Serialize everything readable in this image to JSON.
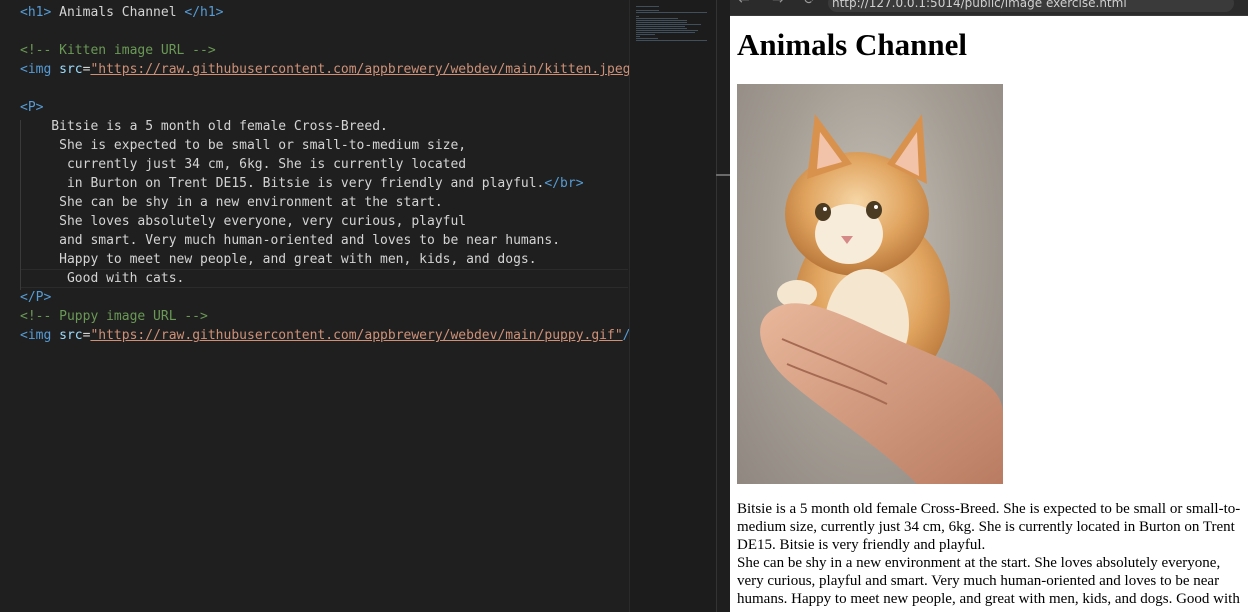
{
  "editor": {
    "lines": [
      [
        {
          "t": "tag",
          "v": "<h1>"
        },
        {
          "t": "txt",
          "v": " Animals Channel "
        },
        {
          "t": "tag",
          "v": "</h1>"
        }
      ],
      [],
      [
        {
          "t": "cmt",
          "v": "<!-- Kitten image URL -->"
        }
      ],
      [
        {
          "t": "tag",
          "v": "<img "
        },
        {
          "t": "attr",
          "v": "src"
        },
        {
          "t": "txt",
          "v": "="
        },
        {
          "t": "str",
          "v": "\"https://raw.githubusercontent.com/appbrewery/webdev/main/kitten.jpeg\""
        }
      ],
      [],
      [
        {
          "t": "tag",
          "v": "<P>"
        }
      ],
      [
        {
          "t": "txt",
          "v": "    Bitsie is a 5 month old female Cross-Breed."
        }
      ],
      [
        {
          "t": "txt",
          "v": "     She is expected to be small or small-to-medium size,"
        }
      ],
      [
        {
          "t": "txt",
          "v": "      currently just 34 cm, 6kg. She is currently located"
        }
      ],
      [
        {
          "t": "txt",
          "v": "      in Burton on Trent DE15. Bitsie is very friendly and playful."
        },
        {
          "t": "tag",
          "v": "</br>"
        }
      ],
      [
        {
          "t": "txt",
          "v": "     She can be shy in a new environment at the start."
        }
      ],
      [
        {
          "t": "txt",
          "v": "     She loves absolutely everyone, very curious, playful"
        }
      ],
      [
        {
          "t": "txt",
          "v": "     and smart. Very much human-oriented and loves to be near humans."
        }
      ],
      [
        {
          "t": "txt",
          "v": "     Happy to meet new people, and great with men, kids, and dogs."
        }
      ],
      [
        {
          "t": "txt",
          "v": "      Good with cats."
        }
      ],
      [
        {
          "t": "tag",
          "v": "</P>"
        }
      ],
      [
        {
          "t": "cmt",
          "v": "<!-- Puppy image URL -->"
        }
      ],
      [
        {
          "t": "tag",
          "v": "<img "
        },
        {
          "t": "attr",
          "v": "src"
        },
        {
          "t": "txt",
          "v": "="
        },
        {
          "t": "str",
          "v": "\"https://raw.githubusercontent.com/appbrewery/webdev/main/puppy.gif\""
        },
        {
          "t": "tag",
          "v": "/>"
        }
      ]
    ]
  },
  "browser": {
    "url": "http://127.0.0.1:5014/public/image exercise.html",
    "nav": {
      "back": "←",
      "forward": "→",
      "reload": "⟳"
    },
    "page_title": "Animals Channel",
    "paragraph_1": "Bitsie is a 5 month old female Cross-Breed. She is expected to be small or small-to-medium size, currently just 34 cm, 6kg. She is currently located in Burton on Trent DE15. Bitsie is very friendly and playful.",
    "paragraph_2": "She can be shy in a new environment at the start. She loves absolutely everyone, very curious, playful and smart. Very much human-oriented and loves to be near humans. Happy to meet new people, and great with men, kids, and dogs. Good with cats."
  },
  "colors": {
    "editor_bg": "#1f1f1f",
    "tag": "#569cd6",
    "attribute": "#9cdcfe",
    "string": "#ce9178",
    "comment": "#6a9955"
  }
}
